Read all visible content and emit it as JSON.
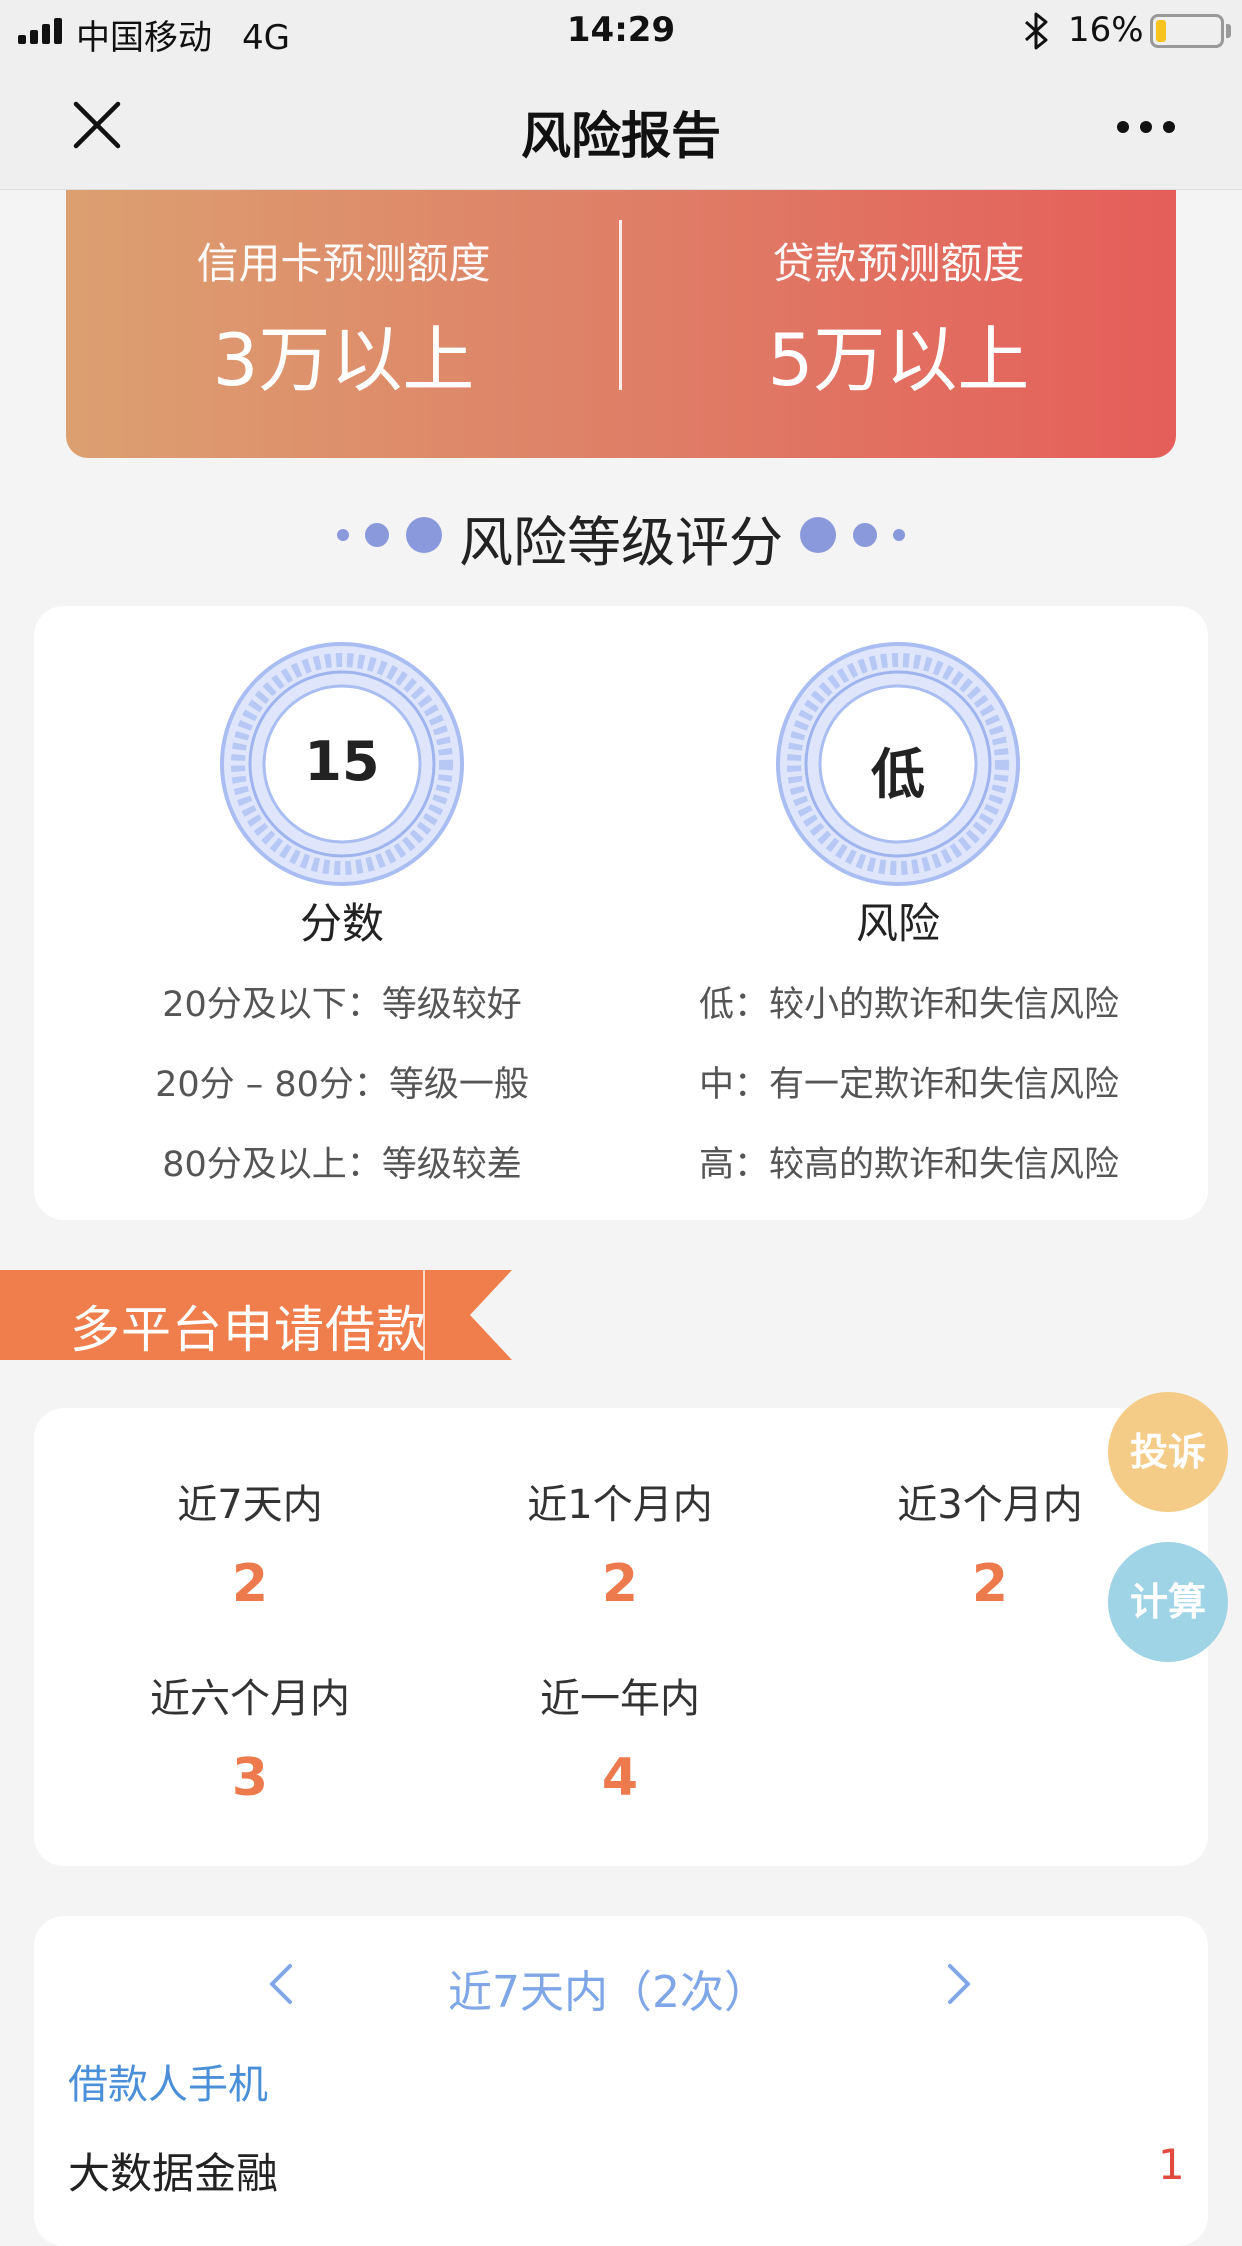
{
  "status_bar": {
    "carrier": "中国移动",
    "network": "4G",
    "time": "14:29",
    "battery": "16%",
    "battery_level": 0.16
  },
  "nav": {
    "title": "风险报告",
    "close_icon": "close-icon",
    "more_icon": "more-icon"
  },
  "banner": {
    "credit_label": "信用卡预测额度",
    "credit_value": "3万以上",
    "loan_label": "贷款预测额度",
    "loan_value": "5万以上",
    "gradient_start": "#dca070",
    "gradient_end": "#e55e59"
  },
  "risk_section": {
    "title": "风险等级评分",
    "score_value": "15",
    "score_caption": "分数",
    "risk_value": "低",
    "risk_caption": "风险",
    "score_legend": [
      "20分及以下：等级较好",
      "20分 – 80分：等级一般",
      "80分及以上：等级较差"
    ],
    "risk_legend": [
      "低：较小的欺诈和失信风险",
      "中：有一定欺诈和失信风险",
      "高：较高的欺诈和失信风险"
    ]
  },
  "multi_platform": {
    "title": "多平台申请借款",
    "ribbon_color": "#ef7e4c",
    "stats": [
      {
        "label": "近7天内",
        "value": "2"
      },
      {
        "label": "近1个月内",
        "value": "2"
      },
      {
        "label": "近3个月内",
        "value": "2"
      },
      {
        "label": "近六个月内",
        "value": "3"
      },
      {
        "label": "近一年内",
        "value": "4"
      }
    ]
  },
  "floating": {
    "complain": "投诉",
    "complain_color": "#f5cc87",
    "calculate": "计算",
    "calculate_color": "#9fd3e6"
  },
  "detail": {
    "period": "近7天内（2次）",
    "section_head": "借款人手机",
    "rows": [
      {
        "label": "大数据金融",
        "count": "1"
      }
    ]
  }
}
